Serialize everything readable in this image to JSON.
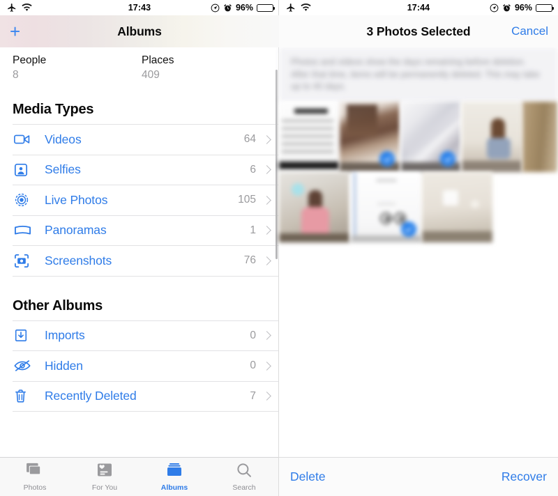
{
  "left": {
    "status_bar": {
      "airplane_icon": "airplane-mode-icon",
      "wifi_icon": "wifi-icon",
      "time": "17:43",
      "location_icon": "location-icon",
      "alarm_icon": "alarm-icon",
      "battery_percent": "96%",
      "battery_icon": "battery-full-icon"
    },
    "navbar": {
      "add_label": "+",
      "title": "Albums"
    },
    "top_stats": [
      {
        "label": "People",
        "count": "8"
      },
      {
        "label": "Places",
        "count": "409"
      }
    ],
    "sections": [
      {
        "title": "Media Types",
        "rows": [
          {
            "icon": "video-camera-icon",
            "label": "Videos",
            "count": "64"
          },
          {
            "icon": "selfie-portrait-icon",
            "label": "Selfies",
            "count": "6"
          },
          {
            "icon": "live-photo-icon",
            "label": "Live Photos",
            "count": "105"
          },
          {
            "icon": "panorama-icon",
            "label": "Panoramas",
            "count": "1"
          },
          {
            "icon": "screenshot-icon",
            "label": "Screenshots",
            "count": "76"
          }
        ]
      },
      {
        "title": "Other Albums",
        "rows": [
          {
            "icon": "import-tray-icon",
            "label": "Imports",
            "count": "0"
          },
          {
            "icon": "eye-slash-icon",
            "label": "Hidden",
            "count": "0"
          },
          {
            "icon": "trash-icon",
            "label": "Recently Deleted",
            "count": "7"
          }
        ]
      }
    ],
    "tabs": [
      {
        "label": "Photos",
        "icon": "photos-icon",
        "active": false
      },
      {
        "label": "For You",
        "icon": "for-you-heart-card-icon",
        "active": false
      },
      {
        "label": "Albums",
        "icon": "albums-folder-icon",
        "active": true
      },
      {
        "label": "Search",
        "icon": "search-magnifier-icon",
        "active": false
      }
    ]
  },
  "right": {
    "status_bar": {
      "airplane_icon": "airplane-mode-icon",
      "wifi_icon": "wifi-icon",
      "time": "17:44",
      "location_icon": "location-icon",
      "alarm_icon": "alarm-icon",
      "battery_percent": "96%",
      "battery_icon": "battery-full-icon"
    },
    "navbar": {
      "title": "3 Photos Selected",
      "cancel_label": "Cancel"
    },
    "notice": "Photos and videos show the days remaining before deletion. After that time, items will be permanently deleted. This may take up to 40 days.",
    "grid": {
      "rows": [
        [
          {
            "name": "photo-document-screenshot",
            "selected": false
          },
          {
            "name": "photo-hallway-interior",
            "selected": true
          },
          {
            "name": "photo-white-fabric-closeup",
            "selected": true
          },
          {
            "name": "photo-woman-sitting-by-wall",
            "selected": false
          },
          {
            "name": "photo-dried-grass-partial",
            "selected": false
          }
        ],
        [
          {
            "name": "photo-woman-pink-jacket",
            "selected": false
          },
          {
            "name": "photo-app-screenshot-eyes",
            "selected": true
          },
          {
            "name": "photo-empty-room",
            "selected": false
          }
        ]
      ]
    },
    "bottom_bar": {
      "delete_label": "Delete",
      "recover_label": "Recover"
    }
  },
  "colors": {
    "accent_blue": "#2f7ce8",
    "selection_blue": "#2680eb",
    "muted_gray": "#9a9a9d",
    "separator": "#e2e2e4"
  }
}
